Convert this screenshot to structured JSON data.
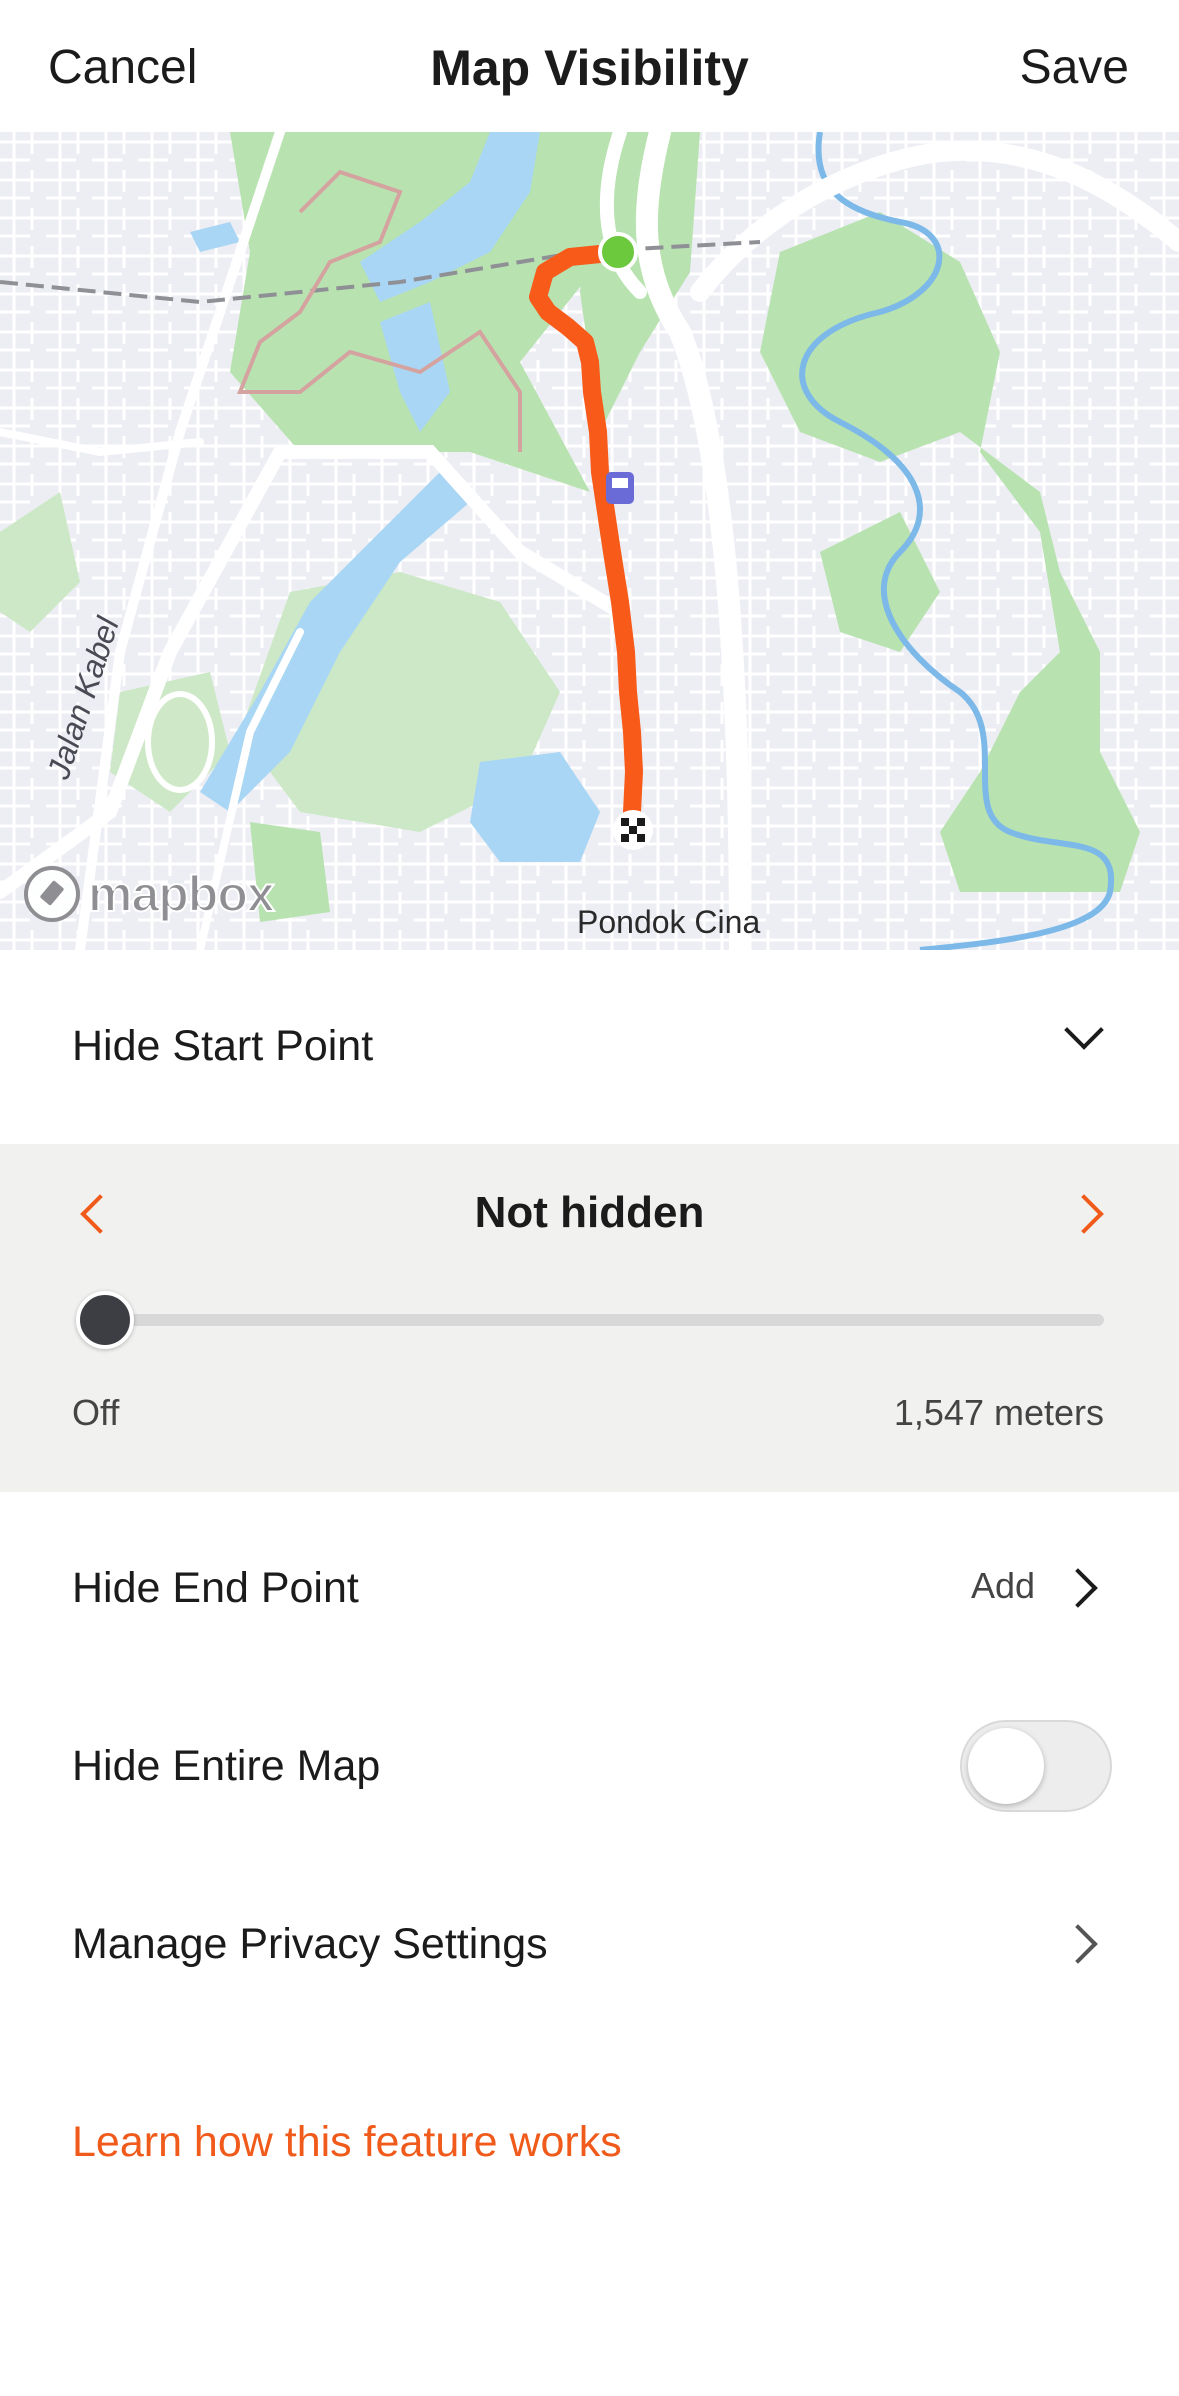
{
  "header": {
    "cancel_label": "Cancel",
    "title": "Map Visibility",
    "save_label": "Save"
  },
  "map": {
    "labels": {
      "jalan_kabel": "Jalan Kabel",
      "pondok_cina": "Pondok Cina"
    },
    "attribution": "mapbox",
    "info_icon": "i",
    "route_color": "#f85a1a",
    "start_marker_color": "#6cc83c"
  },
  "hide_start_point": {
    "label": "Hide Start Point",
    "icon": "chevron-down-icon"
  },
  "start_point_panel": {
    "title": "Not hidden",
    "slider": {
      "min_label": "Off",
      "max_label": "1,547 meters",
      "value_fraction": 0
    },
    "accent_color": "#f05a1a"
  },
  "hide_end_point": {
    "label": "Hide End Point",
    "action_label": "Add"
  },
  "hide_entire_map": {
    "label": "Hide Entire Map",
    "enabled": false
  },
  "manage_privacy": {
    "label": "Manage Privacy Settings"
  },
  "learn_link": {
    "label": "Learn how this feature works"
  }
}
